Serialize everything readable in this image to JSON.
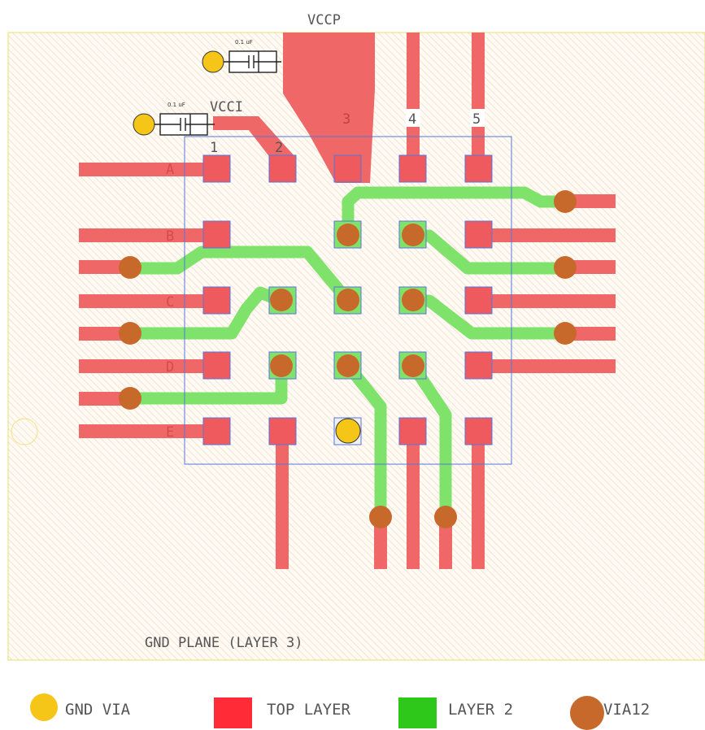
{
  "diagram": {
    "labels": {
      "vccp": "VCCP",
      "vcci": "VCCI",
      "gnd_plane": "GND PLANE (LAYER 3)",
      "cap_top": "0.1 uF",
      "cap_left": "0.1 uF"
    },
    "columns": [
      "1",
      "2",
      "3",
      "4",
      "5"
    ],
    "rows": [
      "A",
      "B",
      "C",
      "D",
      "E"
    ]
  },
  "legend": [
    {
      "label": "GND VIA",
      "color": "#f5c518",
      "shape": "circle"
    },
    {
      "label": "TOP LAYER",
      "color": "#ff2b36",
      "shape": "square"
    },
    {
      "label": "LAYER 2",
      "color": "#2ec81a",
      "shape": "square"
    },
    {
      "label": "VIA12",
      "color": "#c8692c",
      "shape": "circle"
    }
  ],
  "colors": {
    "top_layer": "#f06767",
    "layer2": "#7fe26a",
    "via12": "#c8692c",
    "gnd_via": "#f5c518",
    "pad": "#ee5a5e",
    "outline": "#5577dd",
    "plane_hatch": "#f0d9c4"
  }
}
